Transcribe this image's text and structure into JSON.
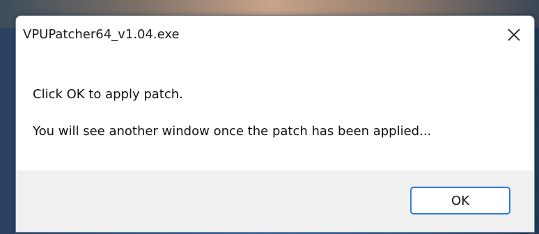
{
  "window": {
    "title": "VPUPatcher64_v1.04.exe",
    "close_icon": "close-icon"
  },
  "message": {
    "line1": "Click OK to apply patch.",
    "line2": "You will see another window once the patch has been applied..."
  },
  "buttons": {
    "ok_label": "OK"
  },
  "colors": {
    "accent": "#2f7bd6",
    "footer_bg": "#f0f0f0"
  }
}
